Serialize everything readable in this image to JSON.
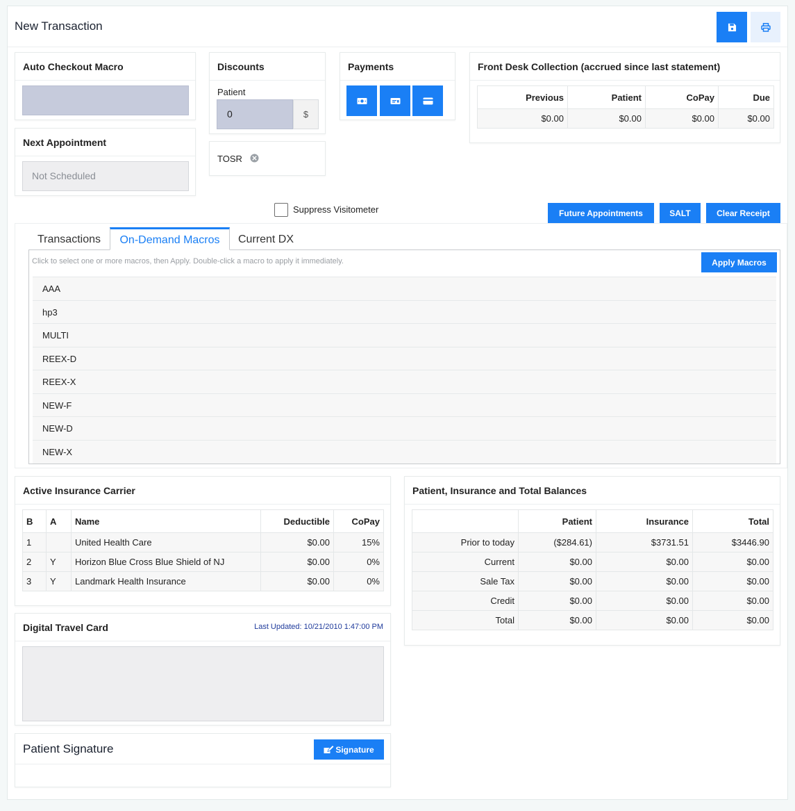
{
  "page": {
    "title": "New Transaction"
  },
  "toolbar": {
    "save_icon": "floppy-disk-icon",
    "print_icon": "printer-icon"
  },
  "auto_checkout": {
    "title": "Auto Checkout Macro"
  },
  "next_appointment": {
    "title": "Next Appointment",
    "value": "Not Scheduled"
  },
  "discounts": {
    "title": "Discounts",
    "patient_label": "Patient",
    "patient_value": "0",
    "currency": "$"
  },
  "tosr": {
    "label": "TOSR"
  },
  "payments": {
    "title": "Payments",
    "icons": [
      "cash-icon",
      "check-card-icon",
      "credit-card-icon"
    ]
  },
  "front_desk": {
    "title": "Front Desk Collection (accrued since last statement)",
    "headers": [
      "Previous",
      "Patient",
      "CoPay",
      "Due"
    ],
    "values": [
      "$0.00",
      "$0.00",
      "$0.00",
      "$0.00"
    ]
  },
  "suppress": {
    "label": "Suppress Visitometer"
  },
  "actions": {
    "future": "Future Appointments",
    "salt": "SALT",
    "clear": "Clear Receipt"
  },
  "tabs": {
    "transactions": "Transactions",
    "macros": "On-Demand Macros",
    "dx": "Current DX"
  },
  "macros": {
    "hint": "Click to select one or more macros, then Apply. Double-click a macro to apply it immediately.",
    "apply": "Apply Macros",
    "items": [
      "AAA",
      "hp3",
      "MULTI",
      "REEX-D",
      "REEX-X",
      "NEW-F",
      "NEW-D",
      "NEW-X"
    ]
  },
  "insurance": {
    "title": "Active Insurance Carrier",
    "headers": [
      "B",
      "A",
      "Name",
      "Deductible",
      "CoPay"
    ],
    "rows": [
      [
        "1",
        "",
        "United Health Care",
        "$0.00",
        "15%"
      ],
      [
        "2",
        "Y",
        "Horizon Blue Cross Blue Shield of NJ",
        "$0.00",
        "0%"
      ],
      [
        "3",
        "Y",
        "Landmark Health Insurance",
        "$0.00",
        "0%"
      ]
    ]
  },
  "balances": {
    "title": "Patient, Insurance and Total Balances",
    "headers": [
      "",
      "Patient",
      "Insurance",
      "Total"
    ],
    "rows": [
      [
        "Prior to today",
        "($284.61)",
        "$3731.51",
        "$3446.90"
      ],
      [
        "Current",
        "$0.00",
        "$0.00",
        "$0.00"
      ],
      [
        "Sale Tax",
        "$0.00",
        "$0.00",
        "$0.00"
      ],
      [
        "Credit",
        "$0.00",
        "$0.00",
        "$0.00"
      ],
      [
        "Total",
        "$0.00",
        "$0.00",
        "$0.00"
      ]
    ]
  },
  "travel_card": {
    "title": "Digital Travel Card",
    "updated": "Last Updated: 10/21/2010 1:47:00 PM"
  },
  "signature": {
    "title": "Patient Signature",
    "button": "Signature",
    "icon": "signature-pen-icon"
  },
  "colors": {
    "accent": "#1a7ff5",
    "link": "#1e3a9b"
  }
}
